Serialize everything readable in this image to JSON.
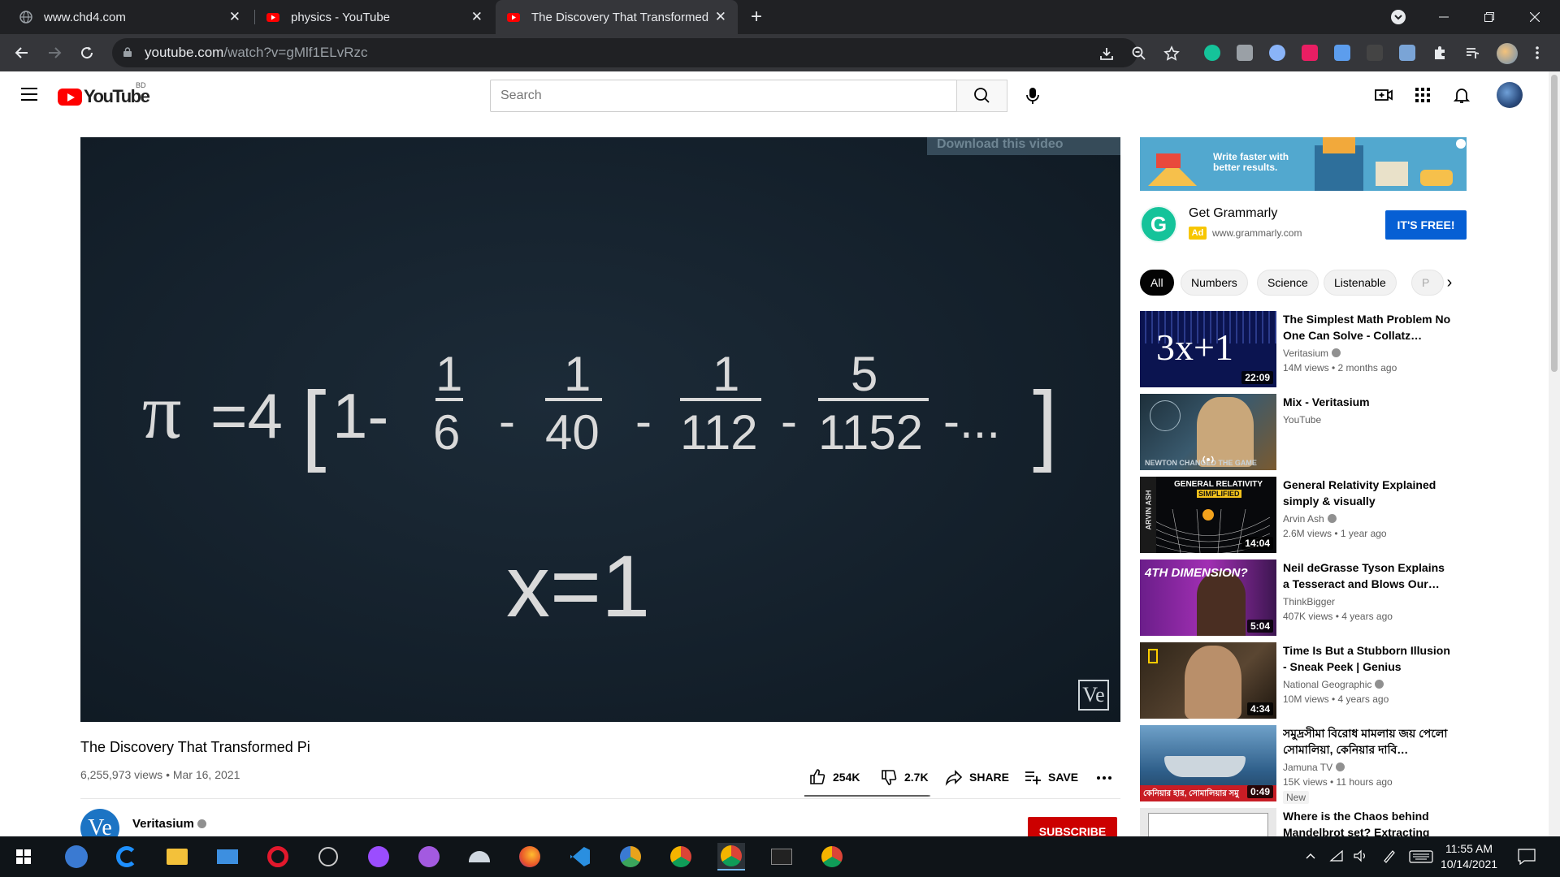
{
  "browser": {
    "tabs": [
      {
        "title": "www.chd4.com",
        "active": false
      },
      {
        "title": "physics - YouTube",
        "active": false
      },
      {
        "title": "The Discovery That Transformed",
        "active": true
      }
    ],
    "url": {
      "host": "youtube.com",
      "path": "/watch?v=gMlf1ELvRzc"
    }
  },
  "masthead": {
    "logo_text": "YouTube",
    "country_code": "BD",
    "search_placeholder": "Search"
  },
  "player": {
    "overlay_banner": "Download this video",
    "watermark": "Ve"
  },
  "video": {
    "title": "The Discovery That Transformed Pi",
    "meta": "6,255,973 views • Mar 16, 2021",
    "likes": "254K",
    "dislikes": "2.7K",
    "share_label": "SHARE",
    "save_label": "SAVE",
    "like_ratio": 0.99,
    "channel": {
      "name": "Veritasium",
      "avatar_text": "Ve"
    },
    "subscribe_label": "SUBSCRIBE"
  },
  "ad": {
    "banner_text_1": "Write faster with",
    "banner_text_2": "better results.",
    "title": "Get Grammarly",
    "badge": "Ad",
    "url": "www.grammarly.com",
    "cta": "IT'S FREE!"
  },
  "chips": [
    "All",
    "Numbers",
    "Science",
    "Listenable",
    "P"
  ],
  "recommendations": [
    {
      "title": "The Simplest Math Problem No One Can Solve - Collatz…",
      "channel": "Veritasium",
      "verified": true,
      "stats": "14M views • 2 months ago",
      "duration": "22:09"
    },
    {
      "title": "Mix - Veritasium",
      "channel": "YouTube",
      "verified": false,
      "stats": "",
      "duration": ""
    },
    {
      "title": "General Relativity Explained simply & visually",
      "channel": "Arvin Ash",
      "verified": true,
      "stats": "2.6M views • 1 year ago",
      "duration": "14:04"
    },
    {
      "title": "Neil deGrasse Tyson Explains a Tesseract and Blows Our…",
      "channel": "ThinkBigger",
      "verified": false,
      "stats": "407K views • 4 years ago",
      "duration": "5:04"
    },
    {
      "title": "Time Is But a Stubborn Illusion - Sneak Peek | Genius",
      "channel": "National Geographic",
      "verified": true,
      "stats": "10M views • 4 years ago",
      "duration": "4:34"
    },
    {
      "title": "সমুদ্রসীমা বিরোধ মামলায় জয় পেলো সোমালিয়া, কেনিয়ার দাবি…",
      "channel": "Jamuna TV",
      "verified": true,
      "stats": "15K views • 11 hours ago",
      "duration": "0:49",
      "badge": "New"
    },
    {
      "title": "Where is the Chaos behind Mandelbrot set? Extracting th…",
      "channel": "",
      "verified": false,
      "stats": "",
      "duration": ""
    }
  ],
  "thumb_text": {
    "collatz": "3x+1",
    "relativity_line1": "GENERAL RELATIVITY",
    "relativity_line2": "SIMPLIFIED",
    "relativity_side": "ARVIN ASH",
    "tesseract": "4TH DIMENSION?",
    "mix_caption": "NEWTON CHANGED THE GAME",
    "jamuna_caption": "কেনিয়ার হার, সোমালিয়ার সমু"
  },
  "taskbar": {
    "time": "11:55 AM",
    "date": "10/14/2021"
  },
  "colors": {
    "brand_red": "#ff0000",
    "subscribe_red": "#cc0000",
    "cta_blue": "#065fd4",
    "chrome_dark": "#202124",
    "chrome_toolbar": "#35363a"
  }
}
